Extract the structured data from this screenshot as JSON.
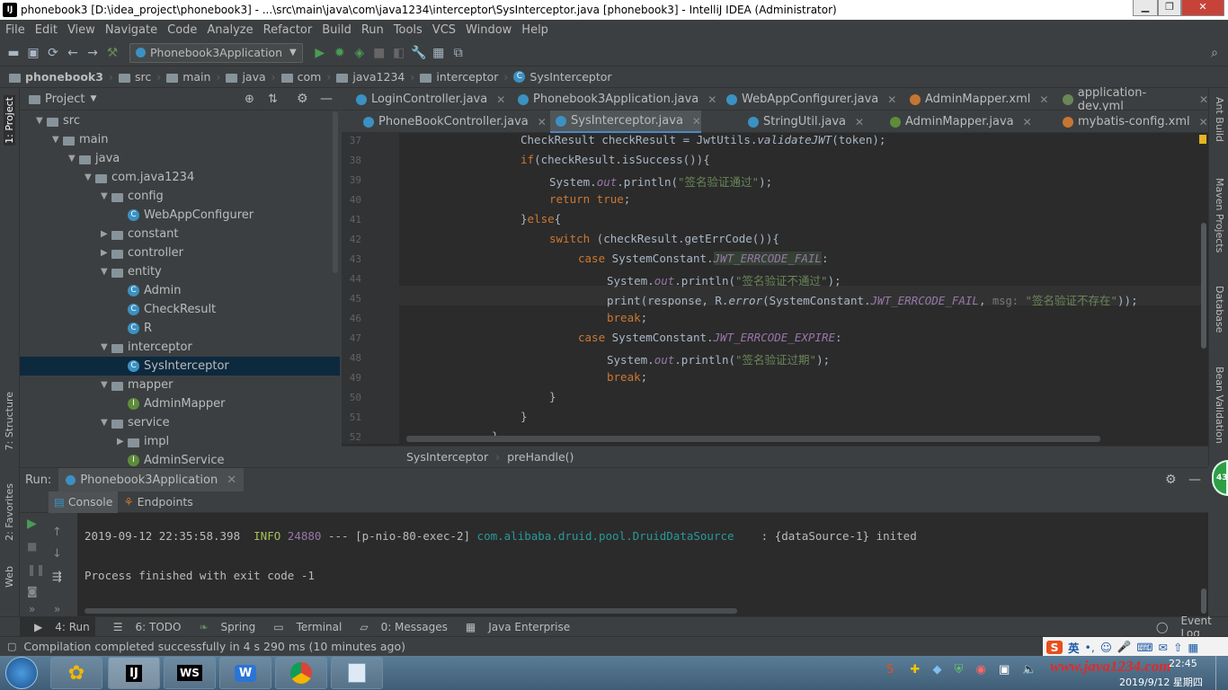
{
  "window": {
    "title": "phonebook3 [D:\\idea_project\\phonebook3] - ...\\src\\main\\java\\com\\java1234\\interceptor\\SysInterceptor.java [phonebook3] - IntelliJ IDEA (Administrator)"
  },
  "menu": [
    "File",
    "Edit",
    "View",
    "Navigate",
    "Code",
    "Analyze",
    "Refactor",
    "Build",
    "Run",
    "Tools",
    "VCS",
    "Window",
    "Help"
  ],
  "toolbar": {
    "run_config": "Phonebook3Application"
  },
  "breadcrumb": [
    "phonebook3",
    "src",
    "main",
    "java",
    "com",
    "java1234",
    "interceptor",
    "SysInterceptor"
  ],
  "project": {
    "header": "Project",
    "tree": [
      {
        "label": "src",
        "indent": 1,
        "kind": "folder",
        "open": true
      },
      {
        "label": "main",
        "indent": 2,
        "kind": "folder",
        "open": true
      },
      {
        "label": "java",
        "indent": 3,
        "kind": "folder",
        "open": true
      },
      {
        "label": "com.java1234",
        "indent": 4,
        "kind": "folder",
        "open": true
      },
      {
        "label": "config",
        "indent": 5,
        "kind": "folder",
        "open": true
      },
      {
        "label": "WebAppConfigurer",
        "indent": 6,
        "kind": "class"
      },
      {
        "label": "constant",
        "indent": 5,
        "kind": "folder",
        "open": false
      },
      {
        "label": "controller",
        "indent": 5,
        "kind": "folder",
        "open": false
      },
      {
        "label": "entity",
        "indent": 5,
        "kind": "folder",
        "open": true
      },
      {
        "label": "Admin",
        "indent": 6,
        "kind": "class"
      },
      {
        "label": "CheckResult",
        "indent": 6,
        "kind": "class"
      },
      {
        "label": "R",
        "indent": 6,
        "kind": "class"
      },
      {
        "label": "interceptor",
        "indent": 5,
        "kind": "folder",
        "open": true
      },
      {
        "label": "SysInterceptor",
        "indent": 6,
        "kind": "class",
        "selected": true
      },
      {
        "label": "mapper",
        "indent": 5,
        "kind": "folder",
        "open": true
      },
      {
        "label": "AdminMapper",
        "indent": 6,
        "kind": "interface"
      },
      {
        "label": "service",
        "indent": 5,
        "kind": "folder",
        "open": true
      },
      {
        "label": "impl",
        "indent": 6,
        "kind": "folder",
        "open": false
      },
      {
        "label": "AdminService",
        "indent": 6,
        "kind": "interface"
      }
    ]
  },
  "tabs_row1": [
    {
      "label": "LoginController.java",
      "color": "#3b91c2"
    },
    {
      "label": "Phonebook3Application.java",
      "color": "#3b91c2"
    },
    {
      "label": "WebAppConfigurer.java",
      "color": "#3b91c2"
    },
    {
      "label": "AdminMapper.xml",
      "color": "#c57633"
    },
    {
      "label": "application-dev.yml",
      "color": "#6a8759"
    }
  ],
  "tabs_row2": [
    {
      "label": "PhoneBookController.java",
      "color": "#3b91c2"
    },
    {
      "label": "SysInterceptor.java",
      "color": "#3b91c2",
      "active": true
    },
    {
      "label": "StringUtil.java",
      "color": "#3b91c2"
    },
    {
      "label": "AdminMapper.java",
      "color": "#5e8c3a"
    },
    {
      "label": "mybatis-config.xml",
      "color": "#c57633"
    }
  ],
  "code": {
    "line_numbers": [
      "37",
      "38",
      "39",
      "40",
      "41",
      "42",
      "43",
      "44",
      "45",
      "46",
      "47",
      "48",
      "49",
      "50",
      "51",
      "52"
    ]
  },
  "editor_breadcrumb": [
    "SysInterceptor",
    "preHandle()"
  ],
  "run": {
    "label": "Run:",
    "config": "Phonebook3Application",
    "tabs": [
      "Console",
      "Endpoints"
    ],
    "log_line": {
      "time": "2019-09-12 22:35:58.398",
      "level": "INFO",
      "pid": "24880",
      "sep": "---",
      "thread": "[p-nio-80-exec-2]",
      "logger": "com.alibaba.druid.pool.DruidDataSource",
      "message": "   : {dataSource-1} inited"
    },
    "exit_line": "Process finished with exit code -1"
  },
  "bottom_tabs": [
    "4: Run",
    "6: TODO",
    "Spring",
    "Terminal",
    "0: Messages",
    "Java Enterprise"
  ],
  "event_log": "Event Log",
  "status": "Compilation completed successfully in 4 s 290 ms (10 minutes ago)",
  "left_tools": [
    "1: Project",
    "7: Structure",
    "2: Favorites",
    "Web"
  ],
  "right_tools": [
    "Ant Build",
    "Maven Projects",
    "Database",
    "Bean Validation"
  ],
  "taskbar": {
    "watermark": "www.java1234.com",
    "date": "2019/9/12 星期四",
    "time": "22:45",
    "ime": "英"
  }
}
